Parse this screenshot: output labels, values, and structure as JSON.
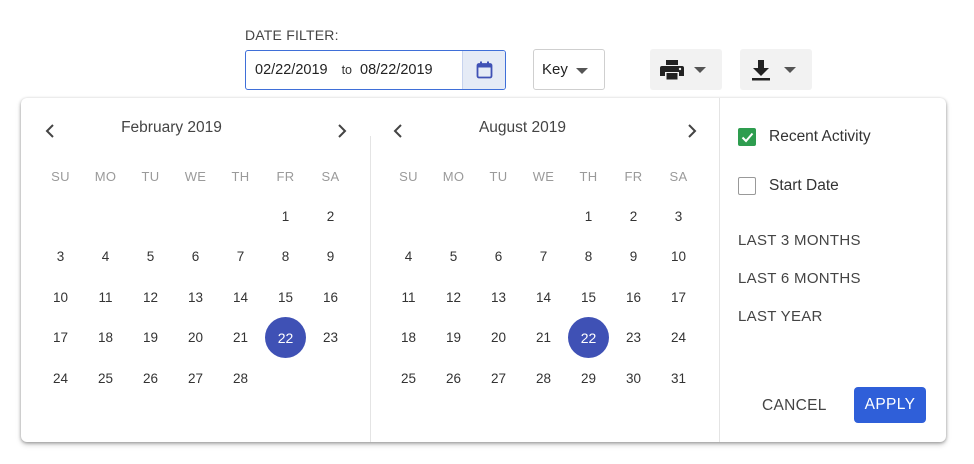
{
  "filter": {
    "label": "DATE FILTER:",
    "from": "02/22/2019",
    "to_label": "to",
    "to": "08/22/2019"
  },
  "key_select": {
    "value": "Key"
  },
  "toolbar": {
    "print_icon": "printer-icon",
    "download_icon": "download-icon"
  },
  "calendars": [
    {
      "title": "February 2019",
      "weekdays": [
        "SU",
        "MO",
        "TU",
        "WE",
        "TH",
        "FR",
        "SA"
      ],
      "days": [
        "",
        "",
        "",
        "",
        "",
        "1",
        "2",
        "3",
        "4",
        "5",
        "6",
        "7",
        "8",
        "9",
        "10",
        "11",
        "12",
        "13",
        "14",
        "15",
        "16",
        "17",
        "18",
        "19",
        "20",
        "21",
        "22",
        "23",
        "24",
        "25",
        "26",
        "27",
        "28"
      ],
      "selected": "22"
    },
    {
      "title": "August 2019",
      "weekdays": [
        "SU",
        "MO",
        "TU",
        "WE",
        "TH",
        "FR",
        "SA"
      ],
      "days": [
        "",
        "",
        "",
        "",
        "1",
        "2",
        "3",
        "4",
        "5",
        "6",
        "7",
        "8",
        "9",
        "10",
        "11",
        "12",
        "13",
        "14",
        "15",
        "16",
        "17",
        "18",
        "19",
        "20",
        "21",
        "22",
        "23",
        "24",
        "25",
        "26",
        "27",
        "28",
        "29",
        "30",
        "31"
      ],
      "selected": "22"
    }
  ],
  "options": {
    "recent_activity": {
      "label": "Recent Activity",
      "checked": true
    },
    "start_date": {
      "label": "Start Date",
      "checked": false
    }
  },
  "ranges": [
    "LAST 3 MONTHS",
    "LAST 6 MONTHS",
    "LAST YEAR"
  ],
  "actions": {
    "cancel": "CANCEL",
    "apply": "APPLY"
  },
  "colors": {
    "accent": "#3f51b5",
    "apply": "#2f5fd9",
    "check": "#2e9d4f",
    "input_border": "#3f6fd8"
  }
}
